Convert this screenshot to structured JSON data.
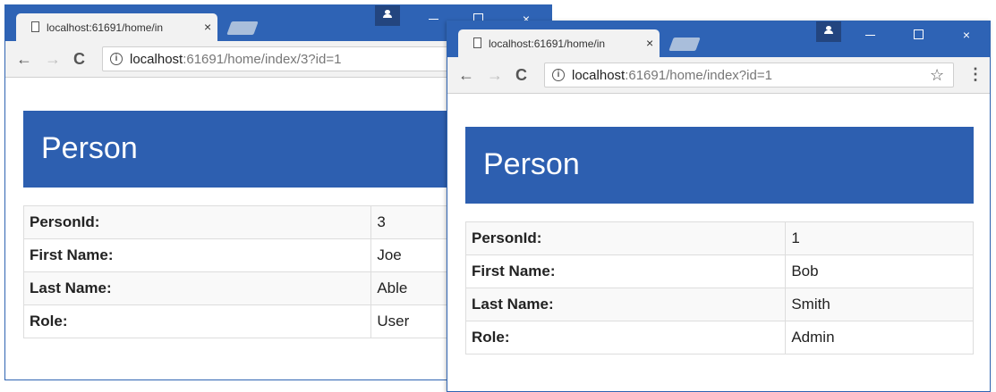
{
  "back_window": {
    "tab_title": "localhost:61691/home/in",
    "url_host": "localhost",
    "url_rest": ":61691/home/index/3?id=1",
    "heading": "Person",
    "rows": [
      {
        "label": "PersonId:",
        "value": "3"
      },
      {
        "label": "First Name:",
        "value": "Joe"
      },
      {
        "label": "Last Name:",
        "value": "Able"
      },
      {
        "label": "Role:",
        "value": "User"
      }
    ]
  },
  "front_window": {
    "tab_title": "localhost:61691/home/in",
    "url_host": "localhost",
    "url_rest": ":61691/home/index?id=1",
    "heading": "Person",
    "rows": [
      {
        "label": "PersonId:",
        "value": "1"
      },
      {
        "label": "First Name:",
        "value": "Bob"
      },
      {
        "label": "Last Name:",
        "value": "Smith"
      },
      {
        "label": "Role:",
        "value": "Admin"
      }
    ]
  },
  "icons": {
    "close": "×",
    "back": "←",
    "forward": "→",
    "reload": "C",
    "info": "i",
    "star": "☆",
    "menu": "⋮"
  },
  "colors": {
    "titlebar": "#2e63b5",
    "heading_bar": "#2d5fb0",
    "heading_text": "#ffffff"
  }
}
